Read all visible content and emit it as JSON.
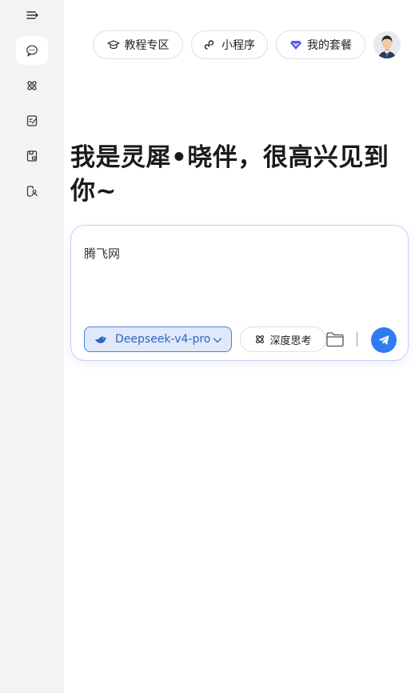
{
  "sidebar": {
    "items": [
      {
        "name": "menu-collapse",
        "icon": "menu-collapse-icon"
      },
      {
        "name": "chat",
        "icon": "chat-bubble-icon",
        "active": true
      },
      {
        "name": "atom",
        "icon": "atom-icon"
      },
      {
        "name": "notes",
        "icon": "note-pen-icon"
      },
      {
        "name": "storage",
        "icon": "save-box-icon"
      },
      {
        "name": "user-doc",
        "icon": "user-doc-icon"
      }
    ]
  },
  "header": {
    "tutorial_label": "教程专区",
    "miniprogram_label": "小程序",
    "package_label": "我的套餐"
  },
  "main": {
    "headline": "我是灵犀•晓伴，很高兴见到你~"
  },
  "chat": {
    "input_text": "腾飞网",
    "model_label": "Deepseek-v4-pro",
    "deep_think_label": "深度思考"
  },
  "colors": {
    "accent": "#2f7cf2",
    "model_bg": "#dfe9f9",
    "model_border": "#4a7de0",
    "sidebar_bg": "#f2f3f5",
    "package_icon": "#5b5ef0"
  }
}
